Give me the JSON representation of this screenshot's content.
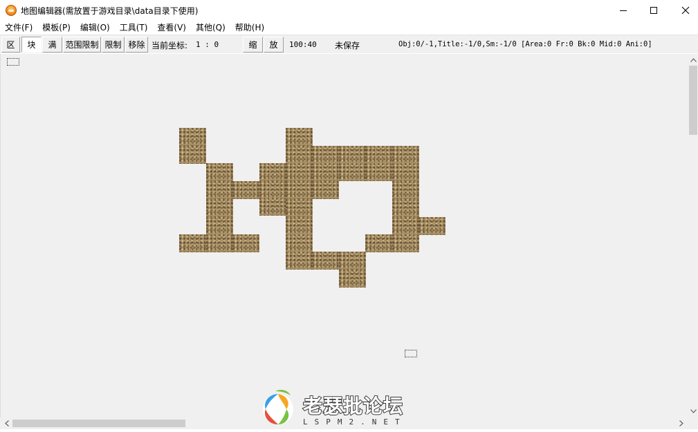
{
  "window": {
    "title": "地图编辑器(需放置于游戏目录\\data目录下使用)",
    "icon": "app-orange-icon"
  },
  "menu": [
    {
      "label": "文件(F)"
    },
    {
      "label": "模板(P)"
    },
    {
      "label": "编辑(O)"
    },
    {
      "label": "工具(T)"
    },
    {
      "label": "查看(V)"
    },
    {
      "label": "其他(Q)"
    },
    {
      "label": "帮助(H)"
    }
  ],
  "toolbar": {
    "area_btn": "区",
    "block_btn": "块",
    "full_btn": "满",
    "range_limit_btn": "范围限制",
    "limit_btn": "限制",
    "remove_btn": "移除",
    "coord_label": "当前坐标:",
    "coord_value": "1 : 0",
    "shrink_btn": "缩",
    "zoom_btn": "放",
    "zoom_value": "100:40",
    "save_status": "未保存",
    "stats": "Obj:0/-1,Title:-1/0,Sm:-1/0 [Area:0 Fr:0 Bk:0 Mid:0 Ani:0]"
  },
  "watermark": {
    "title": "老瑟批论坛",
    "subtitle": "LSPM2.NET"
  },
  "colors": {
    "tile": "#a88e63",
    "canvas": "#f0f0f0",
    "scroll_thumb": "#cdcdcd"
  },
  "icons": [
    "app-orange-icon",
    "minimize-icon",
    "maximize-icon",
    "close-icon",
    "scroll-up-icon",
    "scroll-down-icon",
    "scroll-left-icon",
    "scroll-right-icon"
  ]
}
